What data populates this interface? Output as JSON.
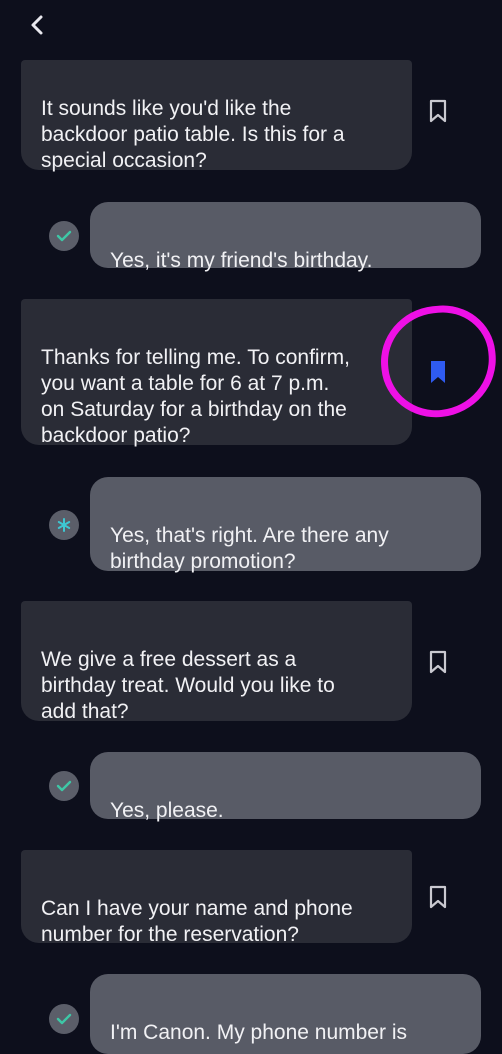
{
  "header": {
    "back_icon": "chevron-left-icon"
  },
  "colors": {
    "background": "#0d0f1c",
    "bot_bubble": "#2a2c36",
    "user_bubble": "#585b66",
    "bookmark_active": "#2f5bf0",
    "sent_check": "#3ec7a6",
    "annotation": "#ee10e6"
  },
  "messages": [
    {
      "sender": "bot",
      "text": "It sounds like you'd like the\nbackdoor patio table. Is this for a\nspecial occasion?",
      "bookmarked": false
    },
    {
      "sender": "user",
      "text": "Yes, it's my friend's birthday.",
      "status_icon": "check-icon"
    },
    {
      "sender": "bot",
      "text": "Thanks for telling me. To confirm,\nyou want a table for 6 at 7 p.m.\non Saturday for a birthday on the\nbackdoor patio?",
      "bookmarked": true
    },
    {
      "sender": "user",
      "text": "Yes, that's right. Are there any\nbirthday promotion?",
      "status_icon": "asterisk-icon"
    },
    {
      "sender": "bot",
      "text": "We give a free dessert as a\nbirthday treat. Would you like to\nadd that?",
      "bookmarked": false
    },
    {
      "sender": "user",
      "text": "Yes, please.",
      "status_icon": "check-icon"
    },
    {
      "sender": "bot",
      "text": "Can I have your name and phone\nnumber for the reservation?",
      "bookmarked": false
    },
    {
      "sender": "user",
      "text": "I'm Canon. My phone number is",
      "status_icon": "check-icon"
    }
  ]
}
